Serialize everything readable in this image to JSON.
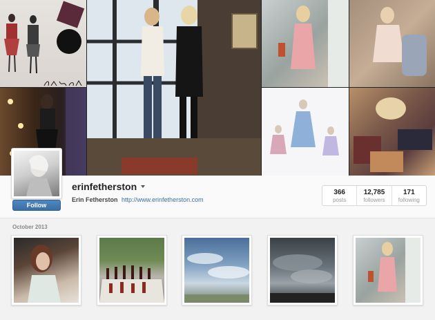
{
  "profile": {
    "username": "erinfetherston",
    "full_name": "Erin Fetherston",
    "website": "http://www.erinfetherston.com",
    "follow_label": "Follow",
    "logo_signature": "Erin Fetherston"
  },
  "stats": [
    {
      "value": "366",
      "label": "posts"
    },
    {
      "value": "12,785",
      "label": "followers"
    },
    {
      "value": "171",
      "label": "following"
    }
  ],
  "feed": {
    "month_label": "October 2013"
  },
  "colors": {
    "follow_button": "#3a6fa4",
    "link": "#3a6fa4",
    "background": "#f2f2f2"
  }
}
